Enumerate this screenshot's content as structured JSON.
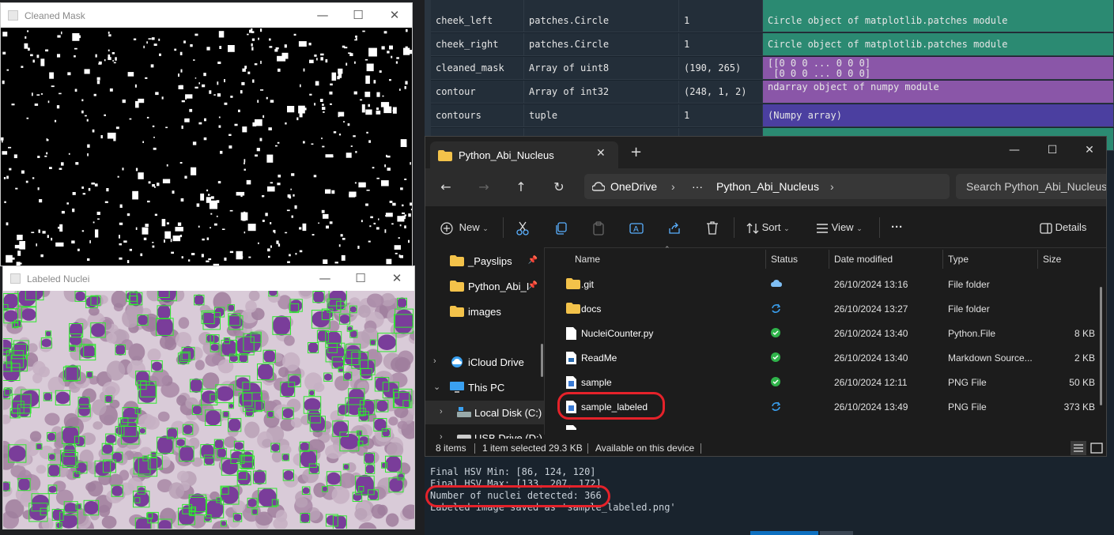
{
  "variable_explorer": {
    "rows": [
      {
        "name": "",
        "type": "",
        "size": "",
        "value": "",
        "color": "green"
      },
      {
        "name": "cheek_left",
        "type": "patches.Circle",
        "size": "1",
        "value": "Circle object of matplotlib.patches module",
        "color": "green"
      },
      {
        "name": "cheek_right",
        "type": "patches.Circle",
        "size": "1",
        "value": "Circle object of matplotlib.patches module",
        "color": "green"
      },
      {
        "name": "cleaned_mask",
        "type": "Array of uint8",
        "size": "(190, 265)",
        "value": "[[0 0 0 ... 0 0 0]\n [0 0 0 ... 0 0 0]",
        "color": "purple"
      },
      {
        "name": "contour",
        "type": "Array of int32",
        "size": "(248, 1, 2)",
        "value": "ndarray object of numpy module",
        "color": "purple"
      },
      {
        "name": "contours",
        "type": "tuple",
        "size": "1",
        "value": "(Numpy array)",
        "color": "blue"
      }
    ]
  },
  "console": {
    "lines": [
      "Final HSV Min: [86, 124, 120]",
      "Final HSV Max: [133, 207, 172]",
      "Number of nuclei detected: 366",
      "Labeled image saved as 'sample_labeled.png'"
    ]
  },
  "cleaned_mask_window": {
    "title": "Cleaned Mask"
  },
  "labeled_nuclei_window": {
    "title": "Labeled Nuclei"
  },
  "explorer": {
    "tab_title": "Python_Abi_Nucleus",
    "address": {
      "root": "OneDrive",
      "ellipsis": "···",
      "folder": "Python_Abi_Nucleus"
    },
    "search_placeholder": "Search Python_Abi_Nucleus",
    "toolbar": {
      "new": "New",
      "sort": "Sort",
      "view": "View",
      "more": "···",
      "details": "Details"
    },
    "nav": [
      {
        "label": "_Payslips",
        "icon": "folder-icon",
        "pinned": true
      },
      {
        "label": "Python_Abi_I",
        "icon": "folder-icon",
        "pinned": true
      },
      {
        "label": "images",
        "icon": "folder-icon",
        "pinned": false
      },
      {
        "label": "iCloud Drive",
        "icon": "cloud-icon",
        "expand": "›"
      },
      {
        "label": "This PC",
        "icon": "pc-icon",
        "expand": "⌄"
      },
      {
        "label": "Local Disk (C:)",
        "icon": "drive-icon",
        "expand": "›"
      },
      {
        "label": "USB Drive (D:)",
        "icon": "usb-icon",
        "expand": "›"
      }
    ],
    "columns": {
      "name": "Name",
      "status": "Status",
      "date": "Date modified",
      "type": "Type",
      "size": "Size"
    },
    "files": [
      {
        "name": ".git",
        "icon": "folder-icon",
        "status": "cloud",
        "date": "26/10/2024 13:16",
        "type": "File folder",
        "size": ""
      },
      {
        "name": "docs",
        "icon": "folder-icon",
        "status": "sync",
        "date": "26/10/2024 13:27",
        "type": "File folder",
        "size": ""
      },
      {
        "name": "NucleiCounter.py",
        "icon": "file-icon",
        "status": "ok",
        "date": "26/10/2024 13:40",
        "type": "Python.File",
        "size": "8 KB"
      },
      {
        "name": "ReadMe",
        "icon": "markdown-file-icon",
        "status": "ok",
        "date": "26/10/2024 13:40",
        "type": "Markdown Source...",
        "size": "2 KB"
      },
      {
        "name": "sample",
        "icon": "png-file-icon",
        "status": "ok",
        "date": "26/10/2024 12:11",
        "type": "PNG File",
        "size": "50 KB"
      },
      {
        "name": "sample_labeled",
        "icon": "png-file-icon",
        "status": "sync",
        "date": "26/10/2024 13:49",
        "type": "PNG File",
        "size": "373 KB"
      }
    ],
    "status": {
      "items": "8 items",
      "selected": "1 item selected",
      "sel_size": "29.3 KB",
      "availability": "Available on this device"
    }
  },
  "colors": {
    "accent": "#0078d4",
    "highlight": "#e5222a",
    "nuclei": "#7a3d9a",
    "box": "#2ee82e"
  }
}
